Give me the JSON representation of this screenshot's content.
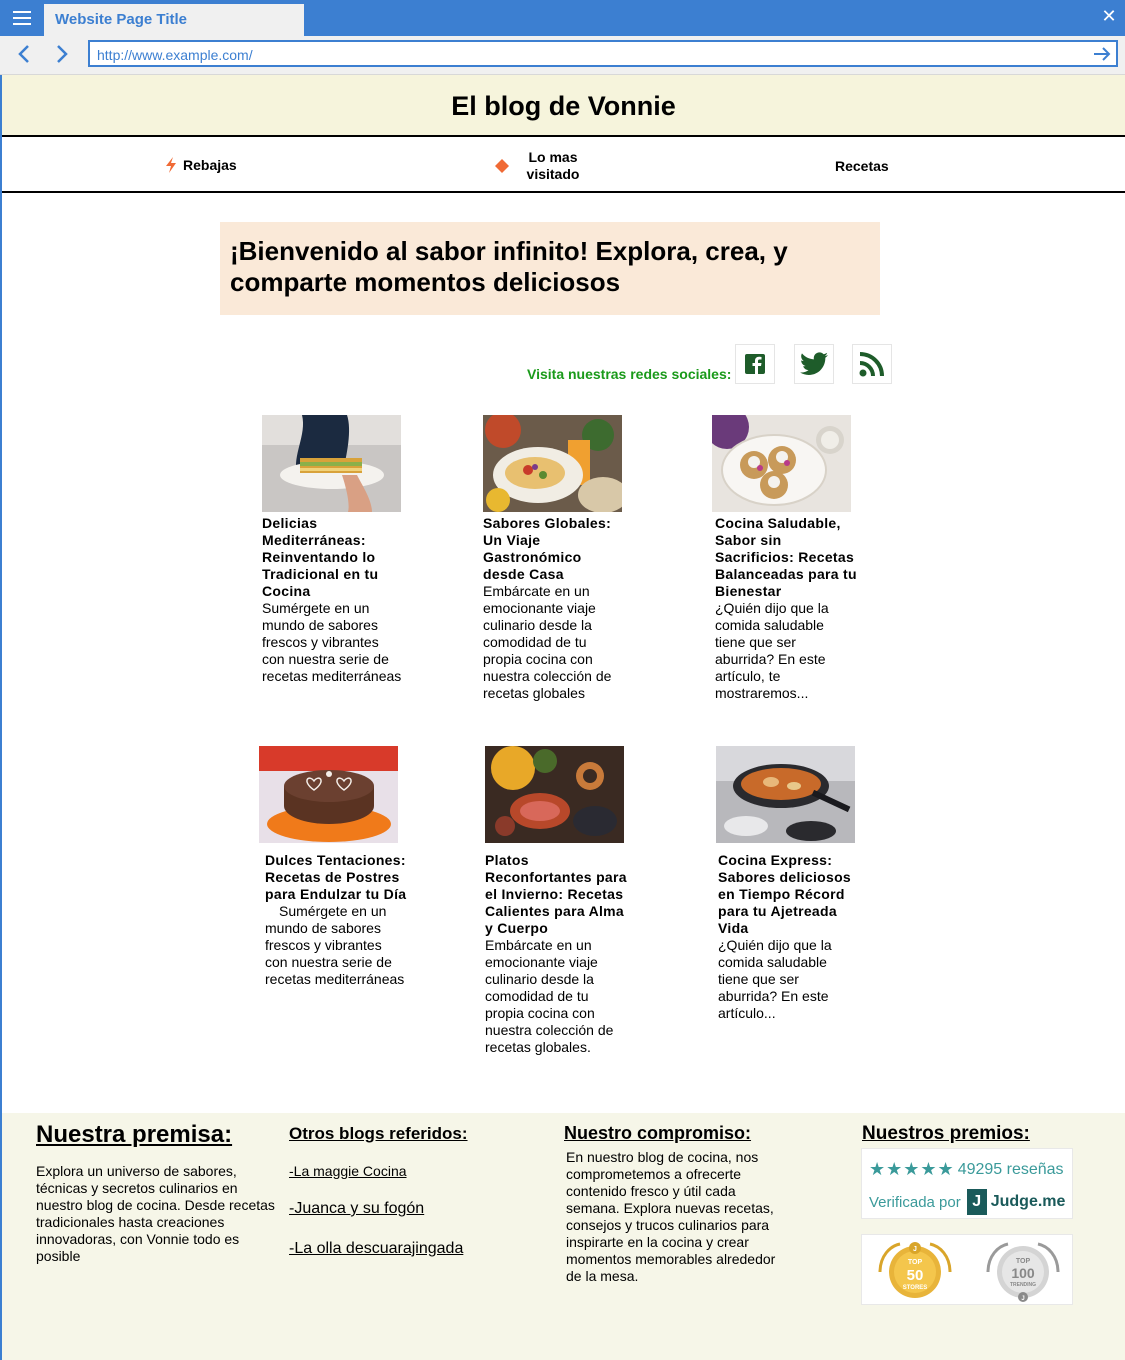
{
  "browser": {
    "tab_title": "Website Page Title",
    "url": "http://www.example.com/"
  },
  "site": {
    "title": "El blog de Vonnie"
  },
  "nav": {
    "items": [
      {
        "label": "Rebajas",
        "icon": "lightning-icon"
      },
      {
        "label": "Lo mas visitado",
        "icon": "diamond-icon"
      },
      {
        "label": "Recetas"
      }
    ]
  },
  "welcome": {
    "text": "¡Bienvenido al sabor infinito!  Explora, crea, y comparte momentos deliciosos"
  },
  "social": {
    "label": "Visita nuestras redes sociales:",
    "icons": [
      "facebook-icon",
      "twitter-icon",
      "rss-icon"
    ],
    "icon_color": "#1e5c2a",
    "label_color": "#1a9a1a"
  },
  "posts": [
    {
      "title": "Delicias Mediterráneas: Reinventando lo Tradicional en tu Cocina",
      "excerpt": "Sumérgete en un mundo de sabores frescos y vibrantes con nuestra serie de recetas mediterráneas",
      "image": "lasagna-photo"
    },
    {
      "title": "Sabores Globales: Un Viaje Gastronómico desde Casa",
      "excerpt": "Embárcate en un emocionante viaje culinario desde la comodidad de tu propia cocina con nuestra colección de recetas globales",
      "image": "tacos-photo"
    },
    {
      "title": "Cocina Saludable, Sabor sin Sacrificios: Recetas Balanceadas para tu Bienestar",
      "excerpt": "¿Quién dijo que la comida saludable tiene que ser aburrida? En este artículo, te mostraremos...",
      "image": "tostadas-photo"
    },
    {
      "title": "Dulces Tentaciones: Recetas de Postres para Endulzar tu Día",
      "excerpt": "Sumérgete en un mundo de sabores frescos y vibrantes con nuestra serie de recetas mediterráneas",
      "image": "cake-photo"
    },
    {
      "title": "Platos Reconfortantes para el Invierno: Recetas Calientes para Alma y Cuerpo",
      "excerpt": "Embárcate en un emocionante viaje culinario desde la comodidad de tu propia cocina con nuestra colección de recetas globales.",
      "image": "tapas-photo"
    },
    {
      "title": "Cocina Express: Sabores deliciosos en Tiempo Récord para tu Ajetreada Vida",
      "excerpt": "¿Quién dijo que la comida saludable tiene que ser aburrida? En este artículo...",
      "image": "stew-pan-photo"
    }
  ],
  "footer": {
    "premise_title": "Nuestra premisa:",
    "premise_text": "Explora un universo de sabores, técnicas y secretos culinarios en nuestro blog de cocina. Desde recetas tradicionales hasta creaciones innovadoras, con Vonnie todo es posible",
    "blogs_title": "Otros blogs referidos:",
    "blogs": [
      "-La maggie Cocina",
      "-Juanca y su fogón",
      "-La olla descuarajingada"
    ],
    "commitment_title": "Nuestro compromiso:",
    "commitment_text": "En nuestro blog de cocina, nos comprometemos a ofrecerte contenido fresco y útil cada semana. Explora nuevas recetas, consejos y trucos culinarios para inspirarte en la cocina y crear momentos memorables alrededor de la mesa.",
    "awards_title": "Nuestros premios:",
    "reviews_count": "49295 reseñas",
    "verified_text": "Verificada por",
    "judge_brand": "Judge.me",
    "judge_letter": "J",
    "stars": 5,
    "badge1": {
      "top": "TOP",
      "number": "50",
      "label": "STORES"
    },
    "badge2": {
      "top": "TOP",
      "number": "100",
      "label": "TRENDING"
    }
  }
}
